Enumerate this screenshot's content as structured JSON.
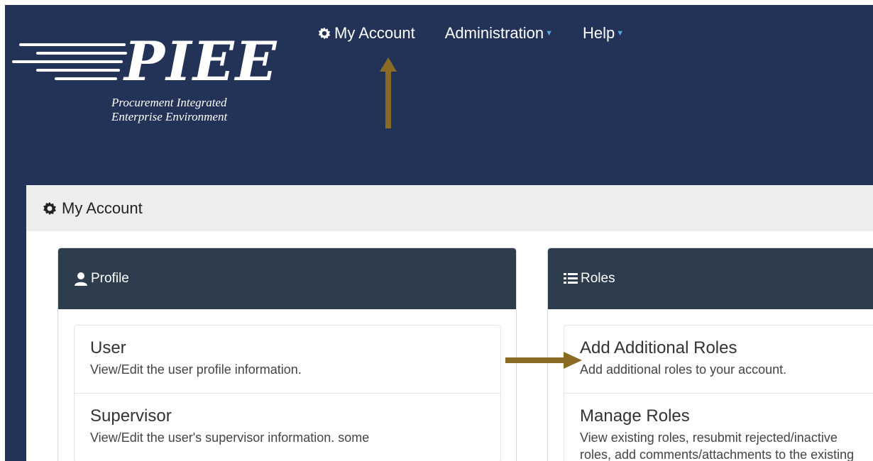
{
  "brand": {
    "wordmark": "PIEE",
    "tagline_line1": "Procurement Integrated",
    "tagline_line2": "Enterprise Environment"
  },
  "nav": {
    "my_account": "My Account",
    "administration": "Administration",
    "help": "Help"
  },
  "panel": {
    "title": "My Account"
  },
  "profile": {
    "header": "Profile",
    "items": [
      {
        "title": "User",
        "desc": "View/Edit the user profile information."
      },
      {
        "title": "Supervisor",
        "desc": "View/Edit the user's supervisor information. some"
      }
    ]
  },
  "roles": {
    "header": "Roles",
    "items": [
      {
        "title": "Add Additional Roles",
        "desc": "Add additional roles to your account."
      },
      {
        "title": "Manage Roles",
        "desc": "View existing roles, resubmit rejected/inactive",
        "desc2": "roles, add comments/attachments to the existing"
      }
    ]
  },
  "colors": {
    "header_bg": "#223357",
    "card_header_bg": "#2e3d4e",
    "annotation_arrow": "#8b6a24",
    "caret": "#5aa7e0"
  },
  "icons": [
    "gear-icon",
    "user-icon",
    "list-icon",
    "caret-down-icon"
  ]
}
